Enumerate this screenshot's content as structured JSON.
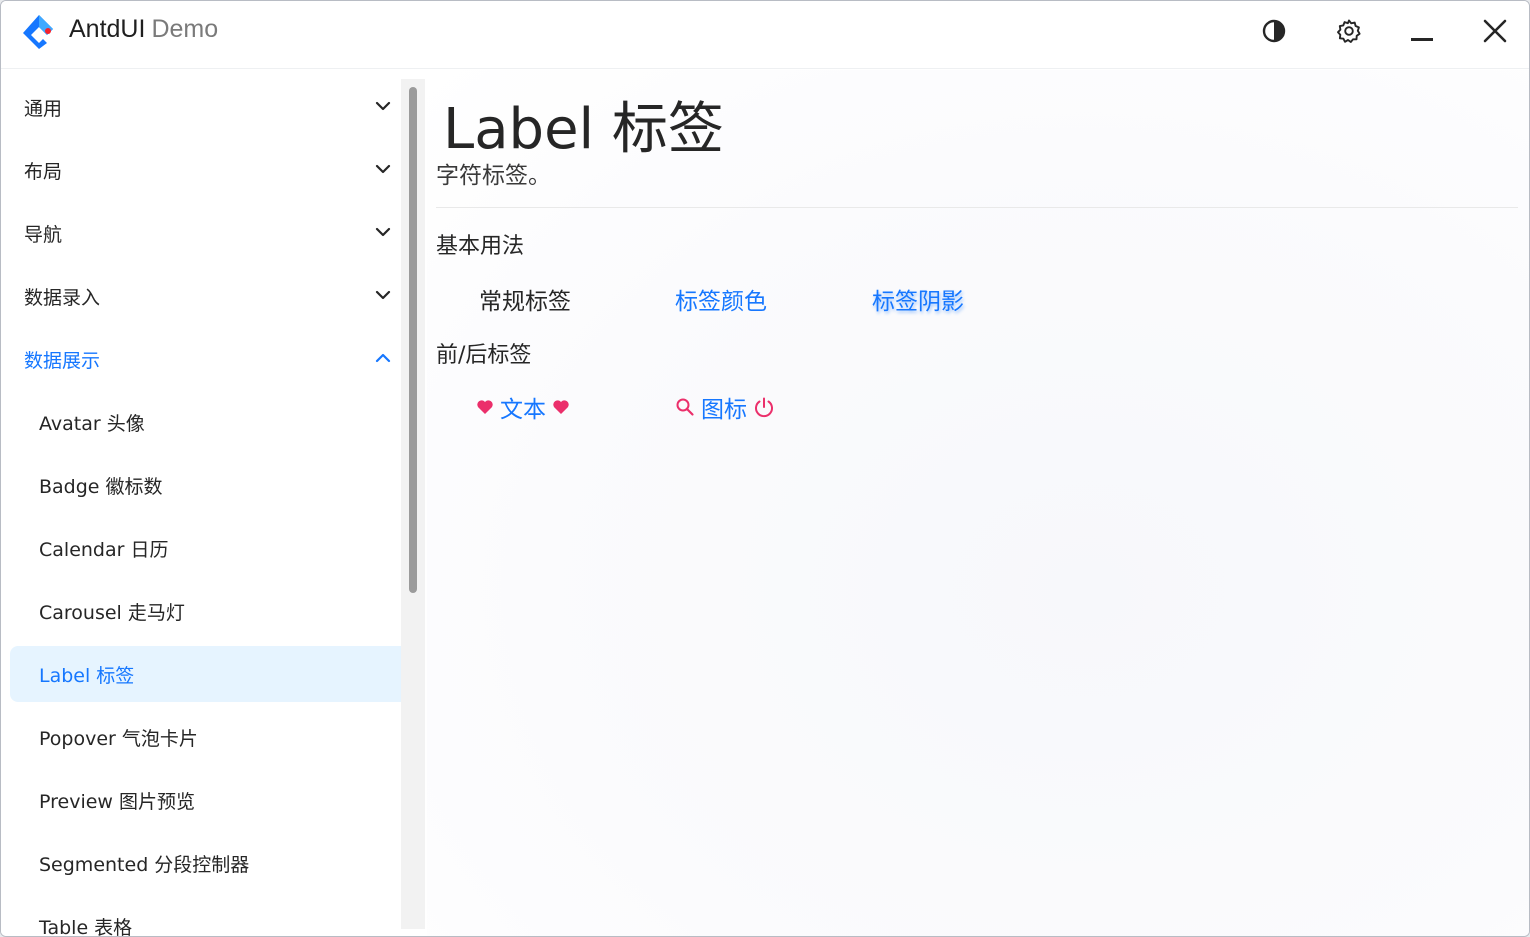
{
  "app": {
    "title_main": "AntdUI",
    "title_sub": "Demo"
  },
  "colors": {
    "accent": "#1677ff",
    "active_bg": "#e6f4ff",
    "icon_pink": "#eb2f6b"
  },
  "titlebar_icons": [
    "theme-toggle-icon",
    "settings-gear-icon",
    "minimize-icon",
    "close-icon"
  ],
  "sidebar": {
    "items": [
      {
        "label": "通用",
        "state": "collapsed"
      },
      {
        "label": "布局",
        "state": "collapsed"
      },
      {
        "label": "导航",
        "state": "collapsed"
      },
      {
        "label": "数据录入",
        "state": "collapsed"
      },
      {
        "label": "数据展示",
        "state": "expanded"
      },
      {
        "label": "Avatar 头像"
      },
      {
        "label": "Badge 徽标数"
      },
      {
        "label": "Calendar 日历"
      },
      {
        "label": "Carousel 走马灯"
      },
      {
        "label": "Label 标签",
        "state": "active"
      },
      {
        "label": "Popover 气泡卡片"
      },
      {
        "label": "Preview 图片预览"
      },
      {
        "label": "Segmented 分段控制器"
      },
      {
        "label": "Table 表格"
      }
    ]
  },
  "page": {
    "title": "Label 标签",
    "description": "字符标签。",
    "sections": [
      {
        "title": "基本用法",
        "tags": [
          "常规标签",
          "标签颜色",
          "标签阴影"
        ]
      },
      {
        "title": "前/后标签",
        "items": [
          {
            "text": "文本",
            "prefix_icon": "heart-icon",
            "suffix_icon": "heart-icon"
          },
          {
            "text": "图标",
            "prefix_icon": "search-icon",
            "suffix_icon": "power-icon"
          }
        ]
      }
    ]
  }
}
